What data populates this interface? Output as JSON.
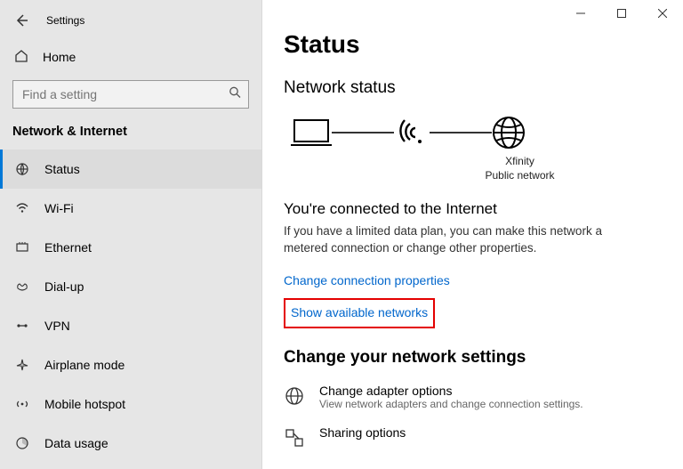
{
  "titlebar": {
    "title": "Settings"
  },
  "home": {
    "label": "Home"
  },
  "search": {
    "placeholder": "Find a setting"
  },
  "section": {
    "title": "Network & Internet"
  },
  "sidebar": {
    "items": [
      {
        "label": "Status"
      },
      {
        "label": "Wi-Fi"
      },
      {
        "label": "Ethernet"
      },
      {
        "label": "Dial-up"
      },
      {
        "label": "VPN"
      },
      {
        "label": "Airplane mode"
      },
      {
        "label": "Mobile hotspot"
      },
      {
        "label": "Data usage"
      }
    ]
  },
  "page": {
    "title": "Status",
    "network_status_heading": "Network status",
    "wifi_name": "Xfinity",
    "wifi_type": "Public network",
    "connected_heading": "You're connected to the Internet",
    "connected_desc": "If you have a limited data plan, you can make this network a metered connection or change other properties.",
    "link_ccp": "Change connection properties",
    "link_show_networks": "Show available networks",
    "change_heading": "Change your network settings",
    "adapter_title": "Change adapter options",
    "adapter_sub": "View network adapters and change connection settings.",
    "sharing_title": "Sharing options"
  }
}
